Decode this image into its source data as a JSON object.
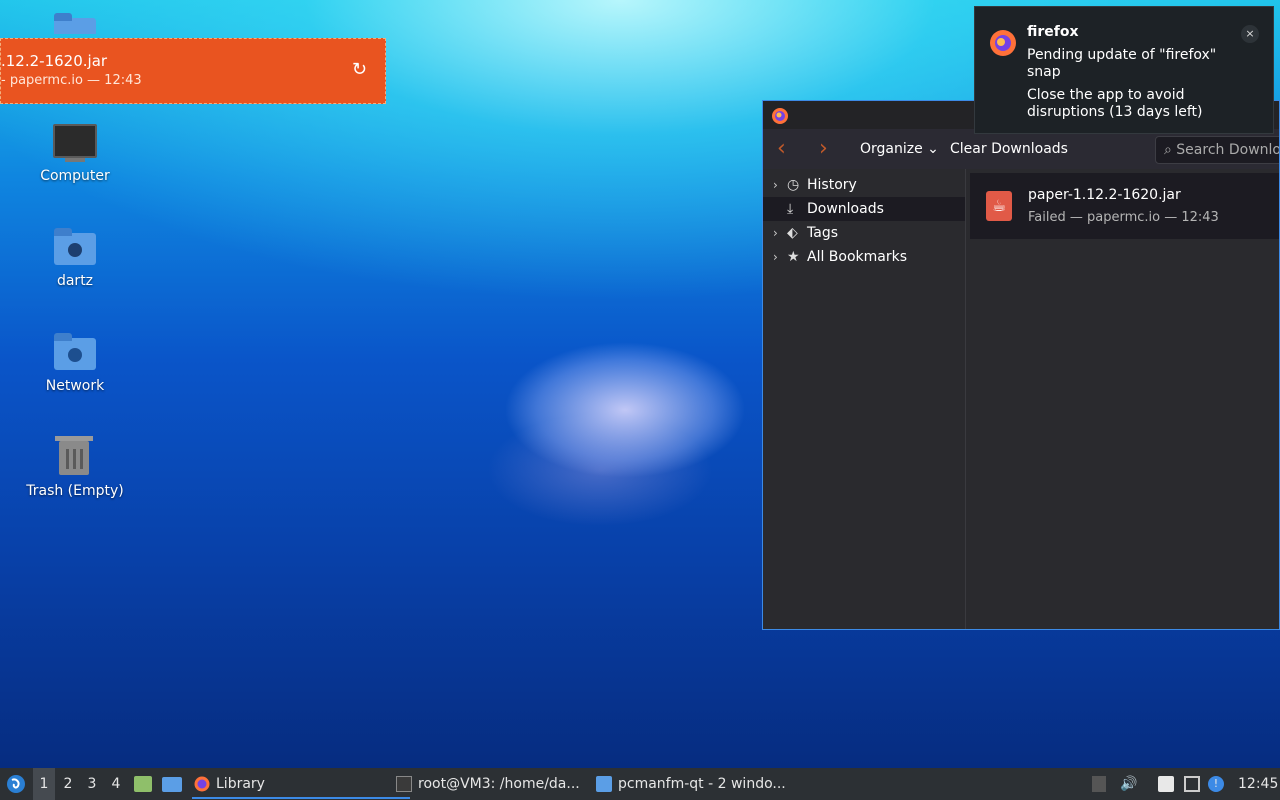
{
  "desktop": {
    "icons": [
      {
        "label": "Computer",
        "icon": "computer-icon"
      },
      {
        "label": "dartz",
        "icon": "home-folder-icon"
      },
      {
        "label": "Network",
        "icon": "network-folder-icon"
      },
      {
        "label": "Trash (Empty)",
        "icon": "trash-icon"
      }
    ]
  },
  "download_toast": {
    "filename": ".12.2-1620.jar",
    "status": "- papermc.io — 12:43",
    "retry_icon": "retry-icon",
    "color": "#e95420"
  },
  "library": {
    "toolbar": {
      "organize": "Organize",
      "clear": "Clear Downloads",
      "search_placeholder": "Search Downlo"
    },
    "sidebar": [
      {
        "label": "History",
        "icon": "clock-icon",
        "expandable": true
      },
      {
        "label": "Downloads",
        "icon": "download-icon",
        "selected": true
      },
      {
        "label": "Tags",
        "icon": "tag-icon",
        "expandable": true
      },
      {
        "label": "All Bookmarks",
        "icon": "star-icon",
        "expandable": true
      }
    ],
    "download": {
      "name": "paper-1.12.2-1620.jar",
      "status": "Failed — papermc.io — 12:43",
      "icon": "java-file-icon"
    }
  },
  "notification": {
    "app": "firefox",
    "line1": "Pending update of \"firefox\" snap",
    "line2": "Close the app to avoid disruptions (13 days left)",
    "close_label": "×"
  },
  "taskbar": {
    "workspaces": [
      "1",
      "2",
      "3",
      "4"
    ],
    "tasks": [
      {
        "label": "Library",
        "icon": "firefox-icon"
      },
      {
        "label": "root@VM3: /home/da...",
        "icon": "terminal-icon"
      },
      {
        "label": "pcmanfm-qt - 2 windo...",
        "icon": "folder-icon"
      }
    ],
    "clock": "12:45"
  },
  "colors": {
    "accent": "#3c8ae6",
    "firefox_back": "#c25a2a"
  }
}
